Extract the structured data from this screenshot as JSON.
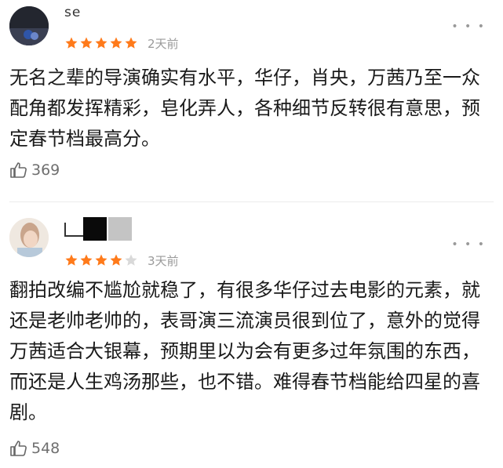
{
  "reviews": [
    {
      "user_name": "se",
      "rating": 5,
      "time": "2天前",
      "text": "无名之辈的导演确实有水平，华仔，肖央，万茜乃至一众配角都发挥精彩，皂化弄人，各种细节反转很有意思，预定春节档最高分。",
      "likes": "369",
      "more": "• • •"
    },
    {
      "user_name": "",
      "rating": 4,
      "time": "3天前",
      "text": "翻拍改编不尴尬就稳了，有很多华仔过去电影的元素，就还是老帅老帅的，表哥演三流演员很到位了，意外的觉得万茜适合大银幕，预期里以为会有更多过年氛围的东西，而还是人生鸡汤那些，也不错。难得春节档能给四星的喜剧。",
      "likes": "548",
      "more": "• • •"
    }
  ],
  "colors": {
    "star_filled": "#ff7a1a",
    "star_empty": "#d9d9d9",
    "meta": "#9a9a9a"
  }
}
